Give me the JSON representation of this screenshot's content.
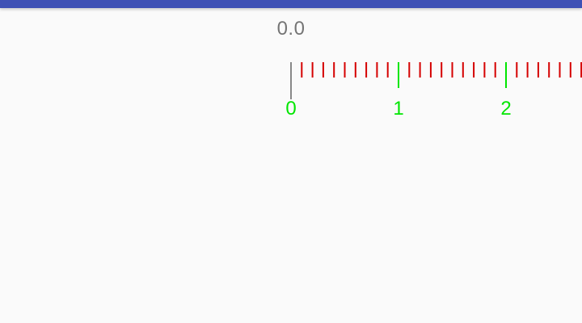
{
  "readout": {
    "value": "0.0"
  },
  "ruler": {
    "min": 0,
    "max": 5,
    "minor_per_major": 10,
    "visible_labels": [
      "0",
      "1",
      "2"
    ],
    "minor_tick_color": "#d50000",
    "major_tick_color": "#00e600",
    "label_color": "#00e600",
    "indicator_color": "#888888"
  },
  "colors": {
    "app_bar": "#3f51b5",
    "background": "#fafafa",
    "readout_text": "#757575"
  }
}
